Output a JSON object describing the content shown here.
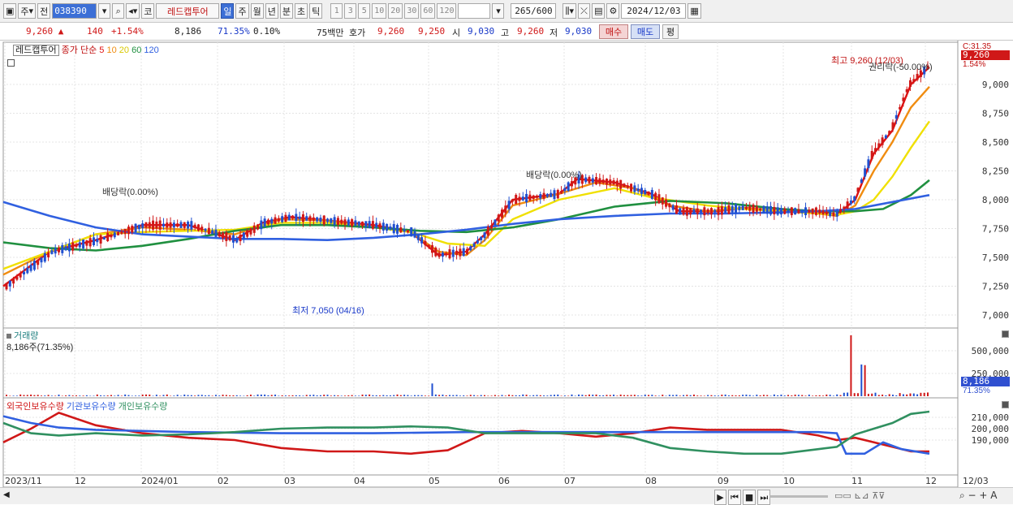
{
  "toolbar": {
    "type_label": "주",
    "prev_label": "전",
    "code": "038390",
    "stock_name": "레드캡투어",
    "code_label": "코",
    "periods": [
      {
        "label": "일",
        "active": true
      },
      {
        "label": "주",
        "active": false
      },
      {
        "label": "월",
        "active": false
      },
      {
        "label": "년",
        "active": false
      },
      {
        "label": "분",
        "active": false
      },
      {
        "label": "초",
        "active": false
      },
      {
        "label": "틱",
        "active": false
      }
    ],
    "intervals": [
      "1",
      "3",
      "5",
      "10",
      "20",
      "30",
      "60",
      "120"
    ],
    "count": "265/600",
    "date": "2024/12/03"
  },
  "quote": {
    "price": "9,260 ▲",
    "change": "140",
    "change_pct": "+1.54%",
    "volume": "8,186",
    "vol_ratio": "71.35%",
    "turnover": "0.10%",
    "amount": "75백만",
    "ask_label": "호가",
    "ask1": "9,260",
    "ask2": "9,250",
    "open_label": "시",
    "open": "9,030",
    "high_label": "고",
    "high": "9,260",
    "low_label": "저",
    "low": "9,030",
    "buy_label": "매수",
    "sell_label": "매도",
    "eval_label": "평"
  },
  "main_chart": {
    "legend_name": "레드캡투어",
    "legend_ma_label": "종가 단순",
    "ma_periods": [
      "5",
      "10",
      "20",
      "60",
      "120"
    ],
    "ma_colors": [
      "#e01010",
      "#f08c10",
      "#f0e000",
      "#209040",
      "#3060e0"
    ],
    "price_tag": "9,260",
    "pct_tag": "1.54%",
    "top_tag": "C:31.35",
    "y_ticks": [
      "9,000",
      "8,750",
      "8,500",
      "8,250",
      "8,000",
      "7,750",
      "7,500",
      "7,250",
      "7,000"
    ],
    "annotations": {
      "high": "최고 9,260 (12/03)",
      "low": "최저 7,050 (04/16)",
      "div1": "배당락(0.00%)",
      "div2": "배당락(0.00%)",
      "rights": "권리락(-50.00%)"
    }
  },
  "volume_chart": {
    "title": "거래량",
    "value_label": "8,186주(71.35%)",
    "y_ticks": [
      "500,000",
      "250,000"
    ],
    "tag_volume": "8,186",
    "tag_pct": "71.35%"
  },
  "holding_chart": {
    "legends": [
      "외국인보유수량",
      "기관보유수량",
      "개인보유수량"
    ],
    "legend_colors": [
      "#d01818",
      "#3060e0",
      "#309060"
    ],
    "y_ticks": [
      "210,000",
      "200,000",
      "190,000"
    ]
  },
  "x_axis": {
    "labels": [
      "2023/11",
      "12",
      "2024/01",
      "02",
      "03",
      "04",
      "05",
      "06",
      "07",
      "08",
      "09",
      "10",
      "11",
      "12",
      "12/03"
    ]
  },
  "chart_data": {
    "type": "candlestick",
    "series": [
      {
        "name": "MA5",
        "points": [
          [
            0,
            7250
          ],
          [
            0.05,
            7550
          ],
          [
            0.1,
            7650
          ],
          [
            0.15,
            7780
          ],
          [
            0.2,
            7780
          ],
          [
            0.25,
            7650
          ],
          [
            0.28,
            7800
          ],
          [
            0.31,
            7850
          ],
          [
            0.35,
            7820
          ],
          [
            0.4,
            7780
          ],
          [
            0.44,
            7720
          ],
          [
            0.47,
            7520
          ],
          [
            0.5,
            7550
          ],
          [
            0.52,
            7700
          ],
          [
            0.55,
            8000
          ],
          [
            0.6,
            8050
          ],
          [
            0.62,
            8180
          ],
          [
            0.66,
            8150
          ],
          [
            0.7,
            8050
          ],
          [
            0.73,
            7900
          ],
          [
            0.77,
            7900
          ],
          [
            0.8,
            7930
          ],
          [
            0.84,
            7900
          ],
          [
            0.88,
            7900
          ],
          [
            0.9,
            7870
          ],
          [
            0.92,
            8000
          ],
          [
            0.94,
            8400
          ],
          [
            0.96,
            8600
          ],
          [
            0.98,
            9000
          ],
          [
            1,
            9150
          ]
        ]
      },
      {
        "name": "MA10",
        "points": [
          [
            0,
            7350
          ],
          [
            0.05,
            7550
          ],
          [
            0.1,
            7700
          ],
          [
            0.15,
            7760
          ],
          [
            0.2,
            7740
          ],
          [
            0.25,
            7700
          ],
          [
            0.3,
            7830
          ],
          [
            0.35,
            7820
          ],
          [
            0.4,
            7760
          ],
          [
            0.44,
            7720
          ],
          [
            0.47,
            7550
          ],
          [
            0.5,
            7520
          ],
          [
            0.52,
            7650
          ],
          [
            0.55,
            7950
          ],
          [
            0.6,
            8050
          ],
          [
            0.64,
            8150
          ],
          [
            0.68,
            8100
          ],
          [
            0.72,
            7950
          ],
          [
            0.76,
            7900
          ],
          [
            0.8,
            7930
          ],
          [
            0.84,
            7900
          ],
          [
            0.88,
            7880
          ],
          [
            0.9,
            7860
          ],
          [
            0.92,
            7950
          ],
          [
            0.94,
            8250
          ],
          [
            0.96,
            8500
          ],
          [
            0.98,
            8800
          ],
          [
            1,
            8980
          ]
        ]
      },
      {
        "name": "MA20",
        "points": [
          [
            0,
            7400
          ],
          [
            0.05,
            7550
          ],
          [
            0.1,
            7700
          ],
          [
            0.15,
            7720
          ],
          [
            0.2,
            7730
          ],
          [
            0.25,
            7740
          ],
          [
            0.3,
            7800
          ],
          [
            0.35,
            7800
          ],
          [
            0.4,
            7760
          ],
          [
            0.44,
            7720
          ],
          [
            0.48,
            7620
          ],
          [
            0.52,
            7600
          ],
          [
            0.55,
            7830
          ],
          [
            0.6,
            8000
          ],
          [
            0.66,
            8100
          ],
          [
            0.7,
            8020
          ],
          [
            0.76,
            7950
          ],
          [
            0.8,
            7920
          ],
          [
            0.84,
            7900
          ],
          [
            0.88,
            7880
          ],
          [
            0.9,
            7870
          ],
          [
            0.92,
            7900
          ],
          [
            0.94,
            8000
          ],
          [
            0.96,
            8200
          ],
          [
            0.98,
            8450
          ],
          [
            1,
            8680
          ]
        ]
      },
      {
        "name": "MA60",
        "points": [
          [
            0,
            7630
          ],
          [
            0.05,
            7580
          ],
          [
            0.1,
            7560
          ],
          [
            0.15,
            7600
          ],
          [
            0.2,
            7660
          ],
          [
            0.25,
            7730
          ],
          [
            0.3,
            7780
          ],
          [
            0.35,
            7780
          ],
          [
            0.4,
            7760
          ],
          [
            0.45,
            7730
          ],
          [
            0.5,
            7720
          ],
          [
            0.55,
            7760
          ],
          [
            0.6,
            7830
          ],
          [
            0.66,
            7940
          ],
          [
            0.72,
            7990
          ],
          [
            0.78,
            7970
          ],
          [
            0.84,
            7920
          ],
          [
            0.88,
            7900
          ],
          [
            0.92,
            7900
          ],
          [
            0.95,
            7920
          ],
          [
            0.98,
            8040
          ],
          [
            1,
            8170
          ]
        ]
      },
      {
        "name": "MA120",
        "points": [
          [
            0,
            7980
          ],
          [
            0.05,
            7860
          ],
          [
            0.1,
            7760
          ],
          [
            0.15,
            7700
          ],
          [
            0.2,
            7680
          ],
          [
            0.25,
            7660
          ],
          [
            0.3,
            7660
          ],
          [
            0.35,
            7650
          ],
          [
            0.4,
            7670
          ],
          [
            0.45,
            7700
          ],
          [
            0.5,
            7740
          ],
          [
            0.55,
            7790
          ],
          [
            0.6,
            7830
          ],
          [
            0.66,
            7860
          ],
          [
            0.72,
            7880
          ],
          [
            0.78,
            7880
          ],
          [
            0.84,
            7890
          ],
          [
            0.88,
            7900
          ],
          [
            0.92,
            7920
          ],
          [
            0.96,
            7980
          ],
          [
            1,
            8040
          ]
        ]
      }
    ],
    "holdings": [
      {
        "name": "외국인보유수량",
        "points": [
          [
            0,
            188000
          ],
          [
            0.03,
            200000
          ],
          [
            0.06,
            214000
          ],
          [
            0.1,
            203000
          ],
          [
            0.15,
            196000
          ],
          [
            0.2,
            192000
          ],
          [
            0.25,
            190000
          ],
          [
            0.3,
            183000
          ],
          [
            0.35,
            180000
          ],
          [
            0.4,
            180000
          ],
          [
            0.44,
            178000
          ],
          [
            0.48,
            181000
          ],
          [
            0.52,
            196000
          ],
          [
            0.56,
            198000
          ],
          [
            0.6,
            196000
          ],
          [
            0.64,
            193000
          ],
          [
            0.68,
            196000
          ],
          [
            0.72,
            201000
          ],
          [
            0.76,
            199000
          ],
          [
            0.8,
            199000
          ],
          [
            0.84,
            199000
          ],
          [
            0.88,
            194000
          ],
          [
            0.9,
            190000
          ],
          [
            0.92,
            192000
          ],
          [
            0.94,
            188000
          ],
          [
            0.96,
            184000
          ],
          [
            0.98,
            180000
          ],
          [
            1,
            180000
          ]
        ]
      },
      {
        "name": "기관보유수량",
        "points": [
          [
            0,
            211000
          ],
          [
            0.03,
            205000
          ],
          [
            0.06,
            201000
          ],
          [
            0.1,
            199000
          ],
          [
            0.2,
            197000
          ],
          [
            0.3,
            196000
          ],
          [
            0.4,
            196000
          ],
          [
            0.5,
            197000
          ],
          [
            0.6,
            197000
          ],
          [
            0.7,
            197000
          ],
          [
            0.8,
            197000
          ],
          [
            0.88,
            197000
          ],
          [
            0.9,
            196000
          ],
          [
            0.91,
            178000
          ],
          [
            0.93,
            178000
          ],
          [
            0.95,
            188000
          ],
          [
            0.97,
            182000
          ],
          [
            1,
            178000
          ]
        ]
      },
      {
        "name": "개인보유수량",
        "points": [
          [
            0,
            205000
          ],
          [
            0.03,
            196000
          ],
          [
            0.06,
            194000
          ],
          [
            0.1,
            196000
          ],
          [
            0.15,
            194000
          ],
          [
            0.2,
            195000
          ],
          [
            0.25,
            197000
          ],
          [
            0.3,
            200000
          ],
          [
            0.35,
            201000
          ],
          [
            0.4,
            201000
          ],
          [
            0.44,
            202000
          ],
          [
            0.48,
            201000
          ],
          [
            0.52,
            196000
          ],
          [
            0.56,
            196000
          ],
          [
            0.6,
            196000
          ],
          [
            0.64,
            196000
          ],
          [
            0.68,
            192000
          ],
          [
            0.72,
            183000
          ],
          [
            0.76,
            180000
          ],
          [
            0.8,
            178000
          ],
          [
            0.84,
            178000
          ],
          [
            0.88,
            182000
          ],
          [
            0.9,
            184000
          ],
          [
            0.92,
            195000
          ],
          [
            0.94,
            200000
          ],
          [
            0.96,
            205000
          ],
          [
            0.98,
            213000
          ],
          [
            1,
            215000
          ]
        ]
      }
    ]
  }
}
